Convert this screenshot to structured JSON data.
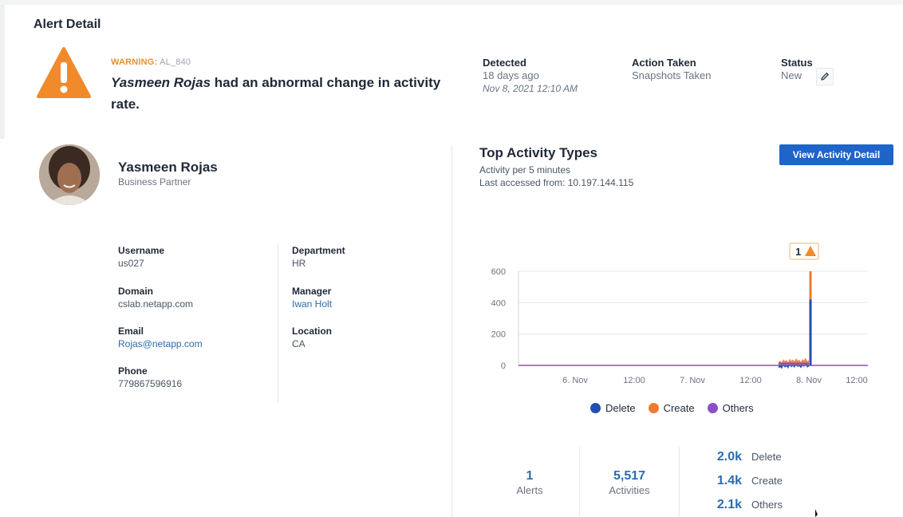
{
  "header": {
    "title": "Alert Detail"
  },
  "alert": {
    "severity": "WARNING:",
    "id": "AL_840",
    "user": "Yasmeen Rojas",
    "message": "had an abnormal change in activity rate."
  },
  "meta": {
    "detected_label": "Detected",
    "detected_relative": "18 days ago",
    "detected_date": "Nov 8, 2021 12:10 AM",
    "action_label": "Action Taken",
    "action_value": "Snapshots Taken",
    "status_label": "Status",
    "status_value": "New"
  },
  "profile": {
    "name": "Yasmeen Rojas",
    "role": "Business Partner",
    "fields": {
      "username_label": "Username",
      "username": "us027",
      "domain_label": "Domain",
      "domain": "cslab.netapp.com",
      "email_label": "Email",
      "email": "Rojas@netapp.com",
      "phone_label": "Phone",
      "phone": "779867596916",
      "department_label": "Department",
      "department": "HR",
      "manager_label": "Manager",
      "manager": "Iwan Holt",
      "location_label": "Location",
      "location": "CA"
    }
  },
  "activity": {
    "title": "Top Activity Types",
    "subtitle": "Activity per 5 minutes",
    "last_accessed": "Last accessed from: 10.197.144.115",
    "view_button": "View Activity Detail",
    "alert_marker": "1"
  },
  "chart_data": {
    "type": "area",
    "ylim": [
      0,
      600
    ],
    "yticks": [
      "0",
      "200",
      "400",
      "600"
    ],
    "xticks": [
      "6. Nov",
      "12:00",
      "7. Nov",
      "12:00",
      "8. Nov",
      "12:00"
    ],
    "grid": true,
    "legend_position": "bottom",
    "series": [
      {
        "name": "Delete",
        "color": "#1f4fb0"
      },
      {
        "name": "Create",
        "color": "#f07a2e"
      },
      {
        "name": "Others",
        "color": "#8b4fc9"
      }
    ],
    "spike_peak": {
      "Delete": 420,
      "Create": 600
    }
  },
  "stats": {
    "alerts_value": "1",
    "alerts_label": "Alerts",
    "activities_value": "5,517",
    "activities_label": "Activities",
    "breakdown": [
      {
        "value": "2.0k",
        "label": "Delete"
      },
      {
        "value": "1.4k",
        "label": "Create"
      },
      {
        "value": "2.1k",
        "label": "Others"
      }
    ]
  }
}
